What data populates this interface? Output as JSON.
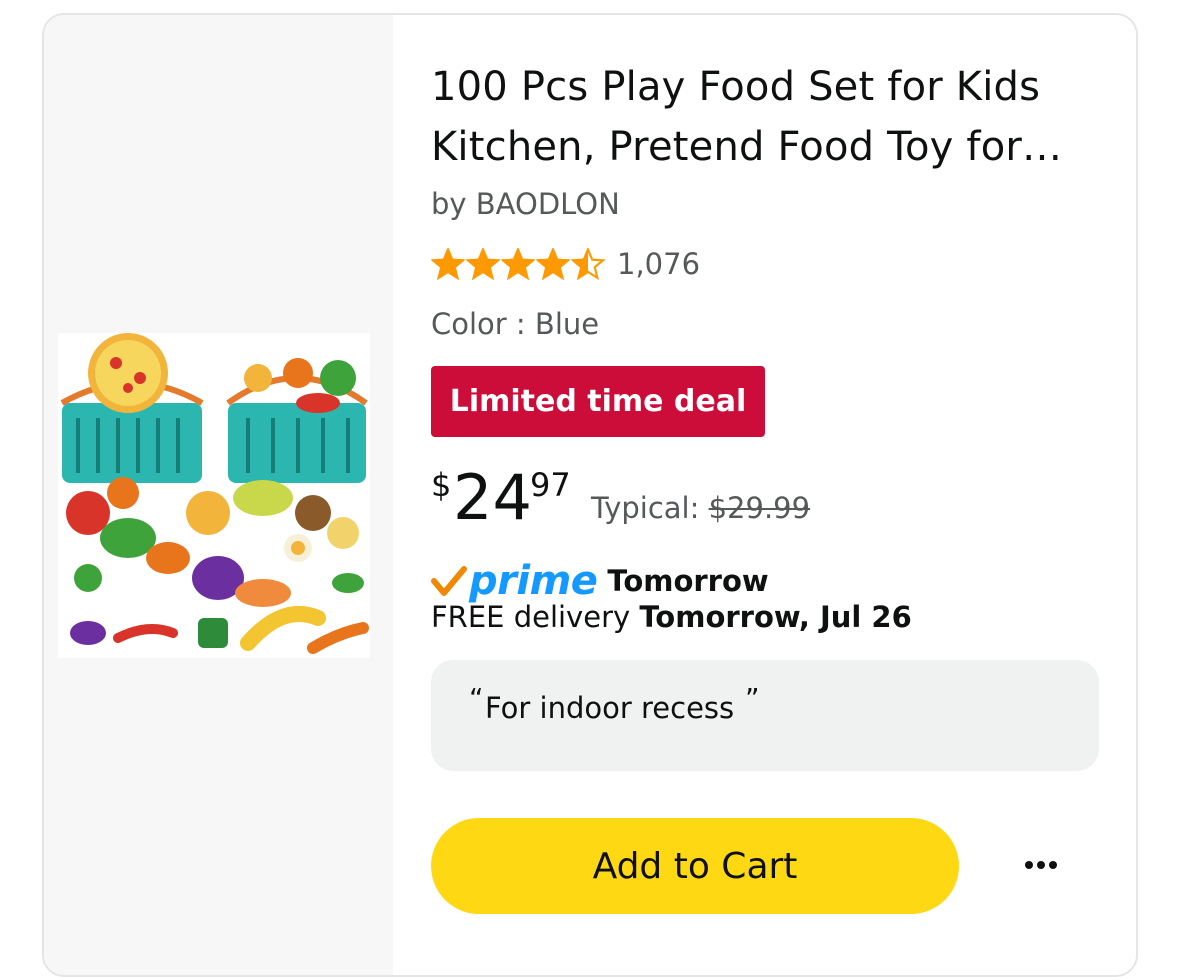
{
  "product": {
    "title_line1": "100 Pcs Play Food Set for Kids",
    "title_line2": "Kitchen, Pretend Food Toy for…",
    "brand": "by BAODLON",
    "rating": 4.5,
    "rating_max": 5,
    "rating_count": "1,076",
    "color_label": "Color : Blue",
    "deal_badge": "Limited time deal",
    "price_symbol": "$",
    "price_whole": "24",
    "price_fraction": "97",
    "typical_label": "Typical:",
    "typical_price": "$29.99",
    "prime_label": "prime",
    "prime_day": "Tomorrow",
    "delivery_prefix": "FREE delivery",
    "delivery_date": "Tomorrow, Jul 26",
    "note_open_quote": "“",
    "note_text": "For indoor recess",
    "note_close_quote": "”",
    "add_to_cart_label": "Add to Cart"
  },
  "icons": {
    "star": "star-icon",
    "prime_check": "prime-check-icon",
    "more": "more-options-icon"
  },
  "colors": {
    "star": "#ff9900",
    "deal_badge": "#cc0c39",
    "prime_blue": "#1399ff",
    "prime_check": "#f08804",
    "add_to_cart": "#ffd814",
    "note_bg": "#f0f2f2",
    "secondary_text": "#565959"
  }
}
